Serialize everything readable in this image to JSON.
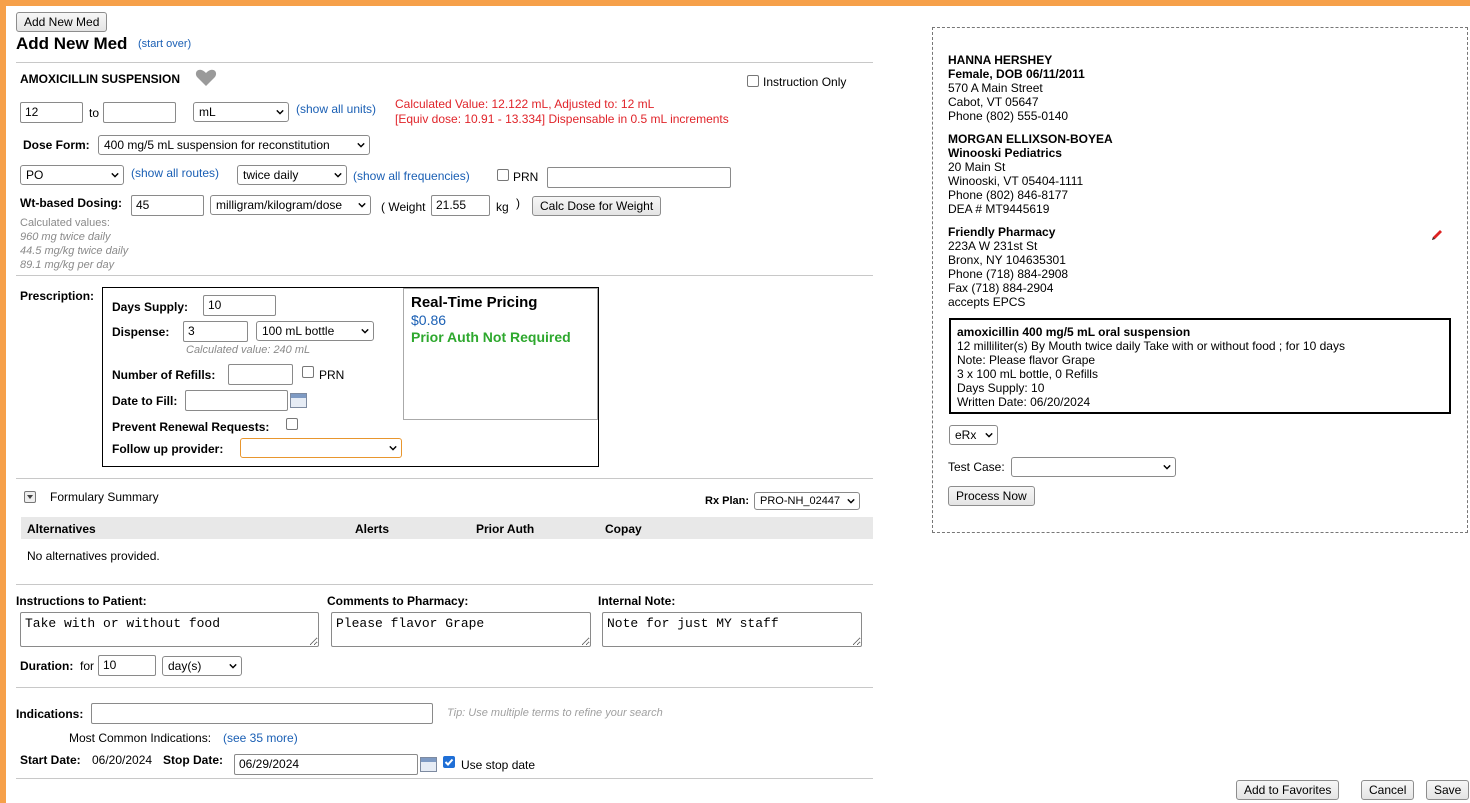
{
  "toolbar": {
    "add_new_med_button": "Add New Med"
  },
  "header": {
    "title": "Add New Med",
    "start_over": "(start over)"
  },
  "med": {
    "name": "AMOXICILLIN SUSPENSION",
    "instruction_only_label": "Instruction Only",
    "dose_from": "12",
    "to_label": "to",
    "dose_to": "",
    "unit": "mL",
    "show_all_units": "(show all units)",
    "calc_line1": "Calculated Value: 12.122 mL, Adjusted to: 12 mL",
    "calc_line2": "[Equiv dose: 10.91 - 13.334] Dispensable in 0.5 mL increments",
    "dose_form_label": "Dose Form:",
    "dose_form": "400 mg/5 mL suspension for reconstitution",
    "route": "PO",
    "show_all_routes": "(show all routes)",
    "frequency": "twice daily",
    "show_all_frequencies": "(show all frequencies)",
    "prn_label": "PRN",
    "prn_text": "",
    "wt_label": "Wt-based Dosing:",
    "wt_dose": "45",
    "wt_unit": "milligram/kilogram/dose",
    "weight_label": "( Weight",
    "weight": "21.55",
    "kg_label": "kg",
    "close_paren": ")",
    "calc_dose_button": "Calc Dose for Weight",
    "calc_values_title": "Calculated values:",
    "calc_values": [
      "960 mg twice daily",
      "44.5 mg/kg twice daily",
      "89.1 mg/kg per day"
    ]
  },
  "prescription": {
    "label": "Prescription:",
    "days_supply_label": "Days Supply:",
    "days_supply": "10",
    "dispense_label": "Dispense:",
    "dispense": "3",
    "dispense_unit": "100 mL bottle",
    "dispense_calc": "Calculated value: 240 mL",
    "refills_label": "Number of Refills:",
    "refills": "",
    "refills_prn": "PRN",
    "date_fill_label": "Date to Fill:",
    "date_fill": "",
    "prevent_renewal_label": "Prevent Renewal Requests:",
    "follow_up_label": "Follow up provider:",
    "follow_up": ""
  },
  "pricing": {
    "title": "Real-Time Pricing",
    "price": "$0.86",
    "auth": "Prior Auth Not Required"
  },
  "formulary": {
    "title": "Formulary Summary",
    "rx_plan_label": "Rx Plan:",
    "rx_plan": "PRO-NH_02447",
    "columns": [
      "Alternatives",
      "Alerts",
      "Prior Auth",
      "Copay"
    ],
    "empty": "No alternatives provided."
  },
  "notes": {
    "patient_label": "Instructions to Patient:",
    "patient": "Take with or without food",
    "pharmacy_label": "Comments to Pharmacy:",
    "pharmacy": "Please flavor Grape",
    "internal_label": "Internal Note:",
    "internal": "Note for just MY staff",
    "duration_label": "Duration:",
    "duration_for": "for",
    "duration": "10",
    "duration_unit": "day(s)"
  },
  "indications": {
    "label": "Indications:",
    "value": "",
    "tip": "Tip: Use multiple terms to refine your search",
    "common_label": "Most Common Indications:",
    "see_more": "(see 35 more)"
  },
  "dates": {
    "start_label": "Start Date:",
    "start": "06/20/2024",
    "stop_label": "Stop Date:",
    "stop": "06/29/2024",
    "use_stop_label": "Use stop date"
  },
  "patient": {
    "name": "HANNA HERSHEY",
    "sex_dob": "Female, DOB 06/11/2011",
    "address1": "570 A Main Street",
    "address2": "Cabot, VT 05647",
    "phone": "Phone (802) 555-0140"
  },
  "provider": {
    "name": "MORGAN ELLIXSON-BOYEA",
    "practice": "Winooski Pediatrics",
    "address1": "20 Main St",
    "address2": "Winooski, VT 05404-1111",
    "phone": "Phone (802) 846-8177",
    "dea": "DEA # MT9445619"
  },
  "pharmacy": {
    "name": "Friendly Pharmacy",
    "address1": "223A W 231st St",
    "address2": "Bronx, NY 104635301",
    "phone": "Phone (718) 884-2908",
    "fax": "Fax (718) 884-2904",
    "epcs": "accepts EPCS"
  },
  "rx_summary": {
    "title": "amoxicillin 400 mg/5 mL oral suspension",
    "sig": "12 milliliter(s) By Mouth twice daily Take with or without food ; for 10 days",
    "note": "Note: Please flavor Grape",
    "qty": "3 x 100 mL bottle, 0 Refills",
    "days": "Days Supply: 10",
    "written": "Written Date: 06/20/2024"
  },
  "send": {
    "method": "eRx",
    "test_case_label": "Test Case:",
    "test_case": "",
    "process_button": "Process Now"
  },
  "footer": {
    "favorites_button": "Add to Favorites",
    "cancel_button": "Cancel",
    "save_button": "Save"
  },
  "colors": {
    "accent_link": "#1a5fb4",
    "error_red": "#e0242a",
    "auth_green": "#2ea82e",
    "border_orange": "#f6a04a"
  }
}
